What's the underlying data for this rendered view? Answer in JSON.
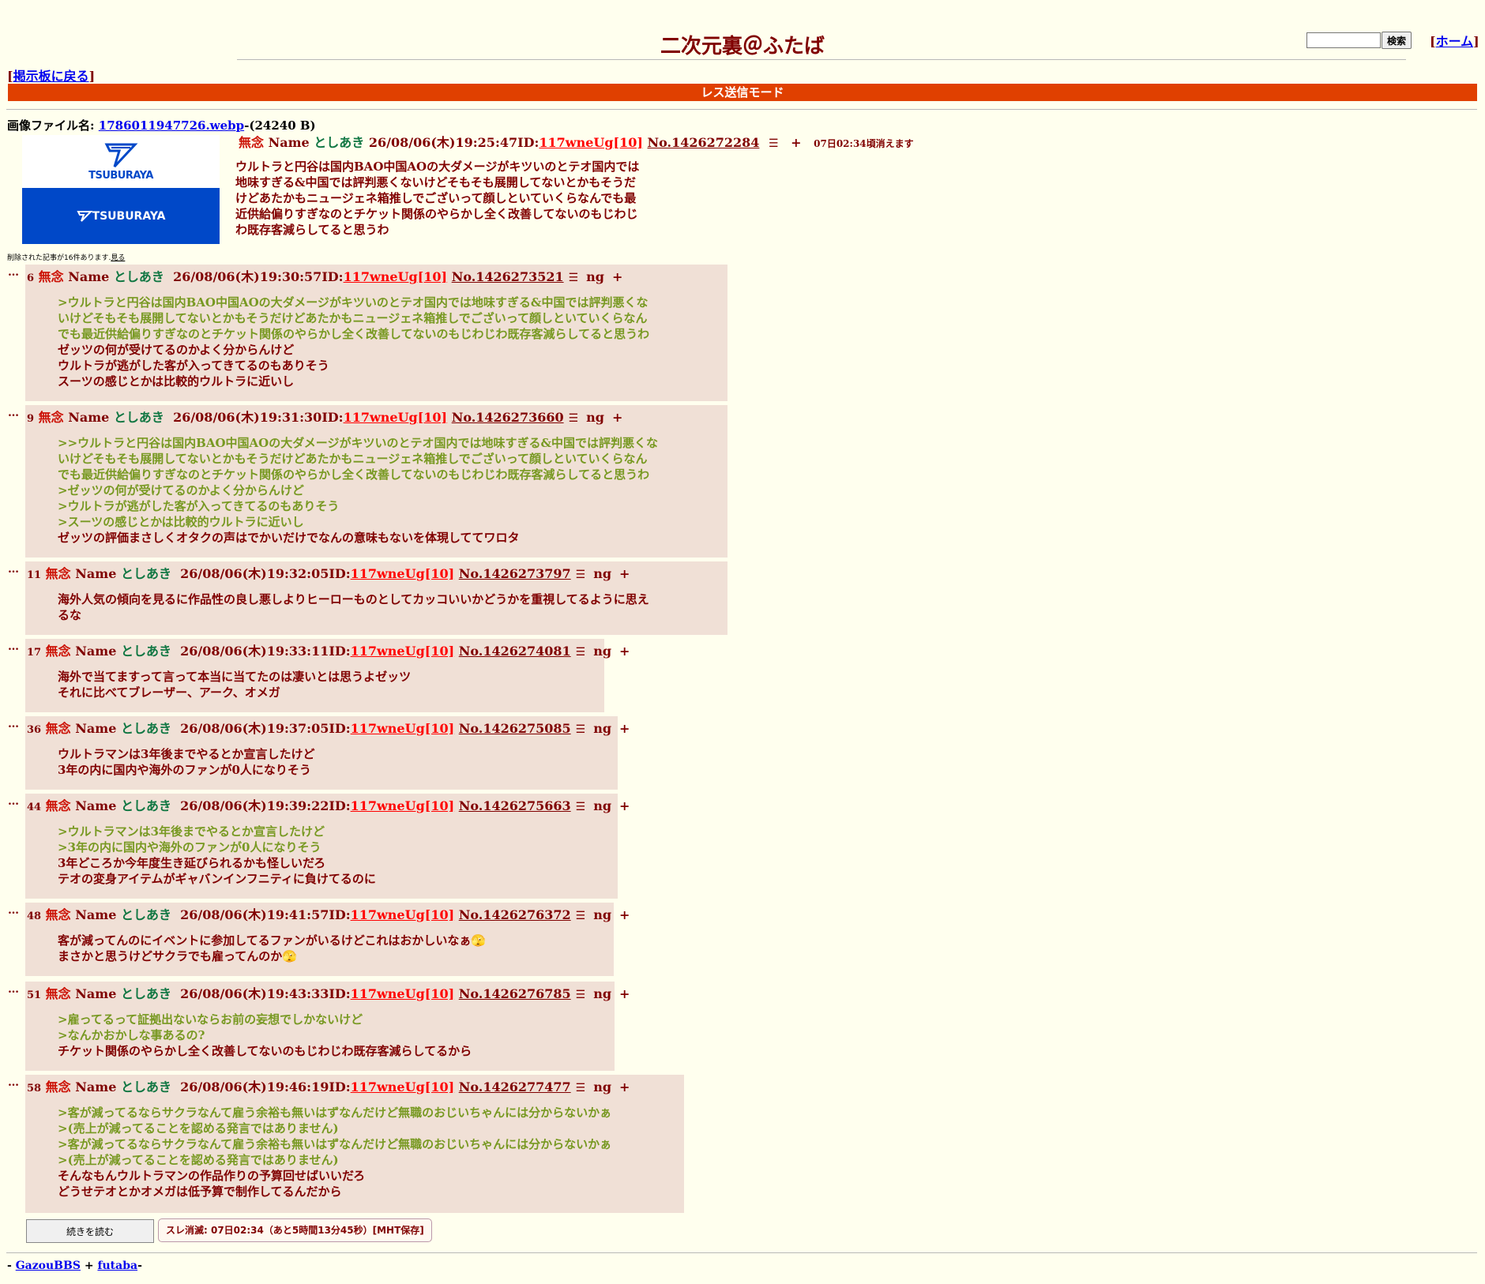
{
  "header": {
    "title": "二次元裏＠ふたば",
    "search_button": "検索",
    "search_value": "",
    "home_link": "ホーム",
    "back_link": "掲示板に戻る",
    "mode_bar": "レス送信モード"
  },
  "file": {
    "label": "画像ファイル名:",
    "filename": "1786011947726.webp",
    "size": "-(24240 B)",
    "thumb_text_top": "TSUBURAYA",
    "thumb_text_bottom": "TSUBURAYA"
  },
  "op": {
    "subject": "無念",
    "name_label": "Name",
    "name": "としあき",
    "date": "26/08/06(木)19:25:47",
    "id_label": "ID:",
    "id": "117wneUg[10]",
    "no": "No.1426272284",
    "menu": "☰",
    "plus": "+",
    "expire": "07日02:34頃消えます",
    "lines": [
      {
        "quote": false,
        "text": "ウルトラと円谷は国内BAO中国AOの大ダメージがキツいのとテオ国内では"
      },
      {
        "quote": false,
        "text": "地味すぎる&中国では評判悪くないけどそもそも展開してないとかもそうだ"
      },
      {
        "quote": false,
        "text": "けどあたかもニュージェネ箱推しでございって顔しといていくらなんでも最"
      },
      {
        "quote": false,
        "text": "近供給偏りすぎなのとチケット関係のやらかし全く改善してないのもじわじ"
      },
      {
        "quote": false,
        "text": "わ既存客減らしてると思うわ"
      }
    ]
  },
  "deleted_notice": "削除された記事が16件あります.",
  "deleted_link": "見る",
  "replies": [
    {
      "num": "6",
      "subject": "無念",
      "name_label": "Name",
      "name": "としあき",
      "date": "26/08/06(木)19:30:57",
      "id_label": "ID:",
      "id": "117wneUg[10]",
      "no": "No.1426273521",
      "ng": "ng",
      "plus": "+",
      "lines": [
        {
          "quote": true,
          "text": ">ウルトラと円谷は国内BAO中国AOの大ダメージがキツいのとテオ国内では地味すぎる&中国では評判悪くな"
        },
        {
          "quote": true,
          "text": "いけどそもそも展開してないとかもそうだけどあたかもニュージェネ箱推しでございって顔しといていくらなん"
        },
        {
          "quote": true,
          "text": "でも最近供給偏りすぎなのとチケット関係のやらかし全く改善してないのもじわじわ既存客減らしてると思うわ"
        },
        {
          "quote": false,
          "text": "ゼッツの何が受けてるのかよく分からんけど"
        },
        {
          "quote": false,
          "text": "ウルトラが逃がした客が入ってきてるのもありそう"
        },
        {
          "quote": false,
          "text": "スーツの感じとかは比較的ウルトラに近いし"
        }
      ]
    },
    {
      "num": "9",
      "subject": "無念",
      "name_label": "Name",
      "name": "としあき",
      "date": "26/08/06(木)19:31:30",
      "id_label": "ID:",
      "id": "117wneUg[10]",
      "no": "No.1426273660",
      "ng": "ng",
      "plus": "+",
      "lines": [
        {
          "quote": true,
          "text": ">>ウルトラと円谷は国内BAO中国AOの大ダメージがキツいのとテオ国内では地味すぎる&中国では評判悪くな"
        },
        {
          "quote": true,
          "text": "いけどそもそも展開してないとかもそうだけどあたかもニュージェネ箱推しでございって顔しといていくらなん"
        },
        {
          "quote": true,
          "text": "でも最近供給偏りすぎなのとチケット関係のやらかし全く改善してないのもじわじわ既存客減らしてると思うわ"
        },
        {
          "quote": true,
          "text": ">ゼッツの何が受けてるのかよく分からんけど"
        },
        {
          "quote": true,
          "text": ">ウルトラが逃がした客が入ってきてるのもありそう"
        },
        {
          "quote": true,
          "text": ">スーツの感じとかは比較的ウルトラに近いし"
        },
        {
          "quote": false,
          "text": "ゼッツの評価まさしくオタクの声はでかいだけでなんの意味もないを体現しててワロタ"
        }
      ]
    },
    {
      "num": "11",
      "subject": "無念",
      "name_label": "Name",
      "name": "としあき",
      "date": "26/08/06(木)19:32:05",
      "id_label": "ID:",
      "id": "117wneUg[10]",
      "no": "No.1426273797",
      "ng": "ng",
      "plus": "+",
      "lines": [
        {
          "quote": false,
          "text": "海外人気の傾向を見るに作品性の良し悪しよりヒーローものとしてカッコいいかどうかを重視してるように思え"
        },
        {
          "quote": false,
          "text": "るな"
        }
      ]
    },
    {
      "num": "17",
      "subject": "無念",
      "name_label": "Name",
      "name": "としあき",
      "date": "26/08/06(木)19:33:11",
      "id_label": "ID:",
      "id": "117wneUg[10]",
      "no": "No.1426274081",
      "ng": "ng",
      "plus": "+",
      "lines": [
        {
          "quote": false,
          "text": "海外で当てますって言って本当に当てたのは凄いとは思うよゼッツ"
        },
        {
          "quote": false,
          "text": "それに比べてブレーザー、アーク、オメガ"
        }
      ]
    },
    {
      "num": "36",
      "subject": "無念",
      "name_label": "Name",
      "name": "としあき",
      "date": "26/08/06(木)19:37:05",
      "id_label": "ID:",
      "id": "117wneUg[10]",
      "no": "No.1426275085",
      "ng": "ng",
      "plus": "+",
      "lines": [
        {
          "quote": false,
          "text": "ウルトラマンは3年後までやるとか宣言したけど"
        },
        {
          "quote": false,
          "text": "3年の内に国内や海外のファンが0人になりそう"
        }
      ]
    },
    {
      "num": "44",
      "subject": "無念",
      "name_label": "Name",
      "name": "としあき",
      "date": "26/08/06(木)19:39:22",
      "id_label": "ID:",
      "id": "117wneUg[10]",
      "no": "No.1426275663",
      "ng": "ng",
      "plus": "+",
      "lines": [
        {
          "quote": true,
          "text": ">ウルトラマンは3年後までやるとか宣言したけど"
        },
        {
          "quote": true,
          "text": ">3年の内に国内や海外のファンが0人になりそう"
        },
        {
          "quote": false,
          "text": "3年どころか今年度生き延びられるかも怪しいだろ"
        },
        {
          "quote": false,
          "text": "テオの変身アイテムがギャバンインフニティに負けてるのに"
        }
      ]
    },
    {
      "num": "48",
      "subject": "無念",
      "name_label": "Name",
      "name": "としあき",
      "date": "26/08/06(木)19:41:57",
      "id_label": "ID:",
      "id": "117wneUg[10]",
      "no": "No.1426276372",
      "ng": "ng",
      "plus": "+",
      "lines": [
        {
          "quote": false,
          "text": "客が減ってんのにイベントに参加してるファンがいるけどこれはおかしいなぁ🫣"
        },
        {
          "quote": false,
          "text": "まさかと思うけどサクラでも雇ってんのか🫣"
        }
      ]
    },
    {
      "num": "51",
      "subject": "無念",
      "name_label": "Name",
      "name": "としあき",
      "date": "26/08/06(木)19:43:33",
      "id_label": "ID:",
      "id": "117wneUg[10]",
      "no": "No.1426276785",
      "ng": "ng",
      "plus": "+",
      "lines": [
        {
          "quote": true,
          "text": ">雇ってるって証拠出ないならお前の妄想でしかないけど"
        },
        {
          "quote": true,
          "text": ">なんかおかしな事あるの?"
        },
        {
          "quote": false,
          "text": "チケット関係のやらかし全く改善してないのもじわじわ既存客減らしてるから"
        }
      ]
    },
    {
      "num": "58",
      "subject": "無念",
      "name_label": "Name",
      "name": "としあき",
      "date": "26/08/06(木)19:46:19",
      "id_label": "ID:",
      "id": "117wneUg[10]",
      "no": "No.1426277477",
      "ng": "ng",
      "plus": "+",
      "lines": [
        {
          "quote": true,
          "text": ">客が減ってるならサクラなんて雇う余裕も無いはずなんだけど無職のおじいちゃんには分からないかぁ"
        },
        {
          "quote": true,
          "text": ">(売上が減ってることを認める発言ではありません)"
        },
        {
          "quote": true,
          "text": ">客が減ってるならサクラなんて雇う余裕も無いはずなんだけど無職のおじいちゃんには分からないかぁ"
        },
        {
          "quote": true,
          "text": ">(売上が減ってることを認める発言ではありません)"
        },
        {
          "quote": false,
          "text": "そんなもんウルトラマンの作品作りの予算回せばいいだろ"
        },
        {
          "quote": false,
          "text": "どうせテオとかオメガは低予算で制作してるんだから"
        }
      ]
    }
  ],
  "bottom": {
    "read_more": "続きを読む",
    "thread_end": "スレ消滅: 07日02:34（あと5時間13分45秒）[MHT保存]"
  },
  "footer": {
    "prefix": "- ",
    "link1": "GazouBBS",
    "sep": " + ",
    "link2": "futaba",
    "suffix": "-"
  }
}
